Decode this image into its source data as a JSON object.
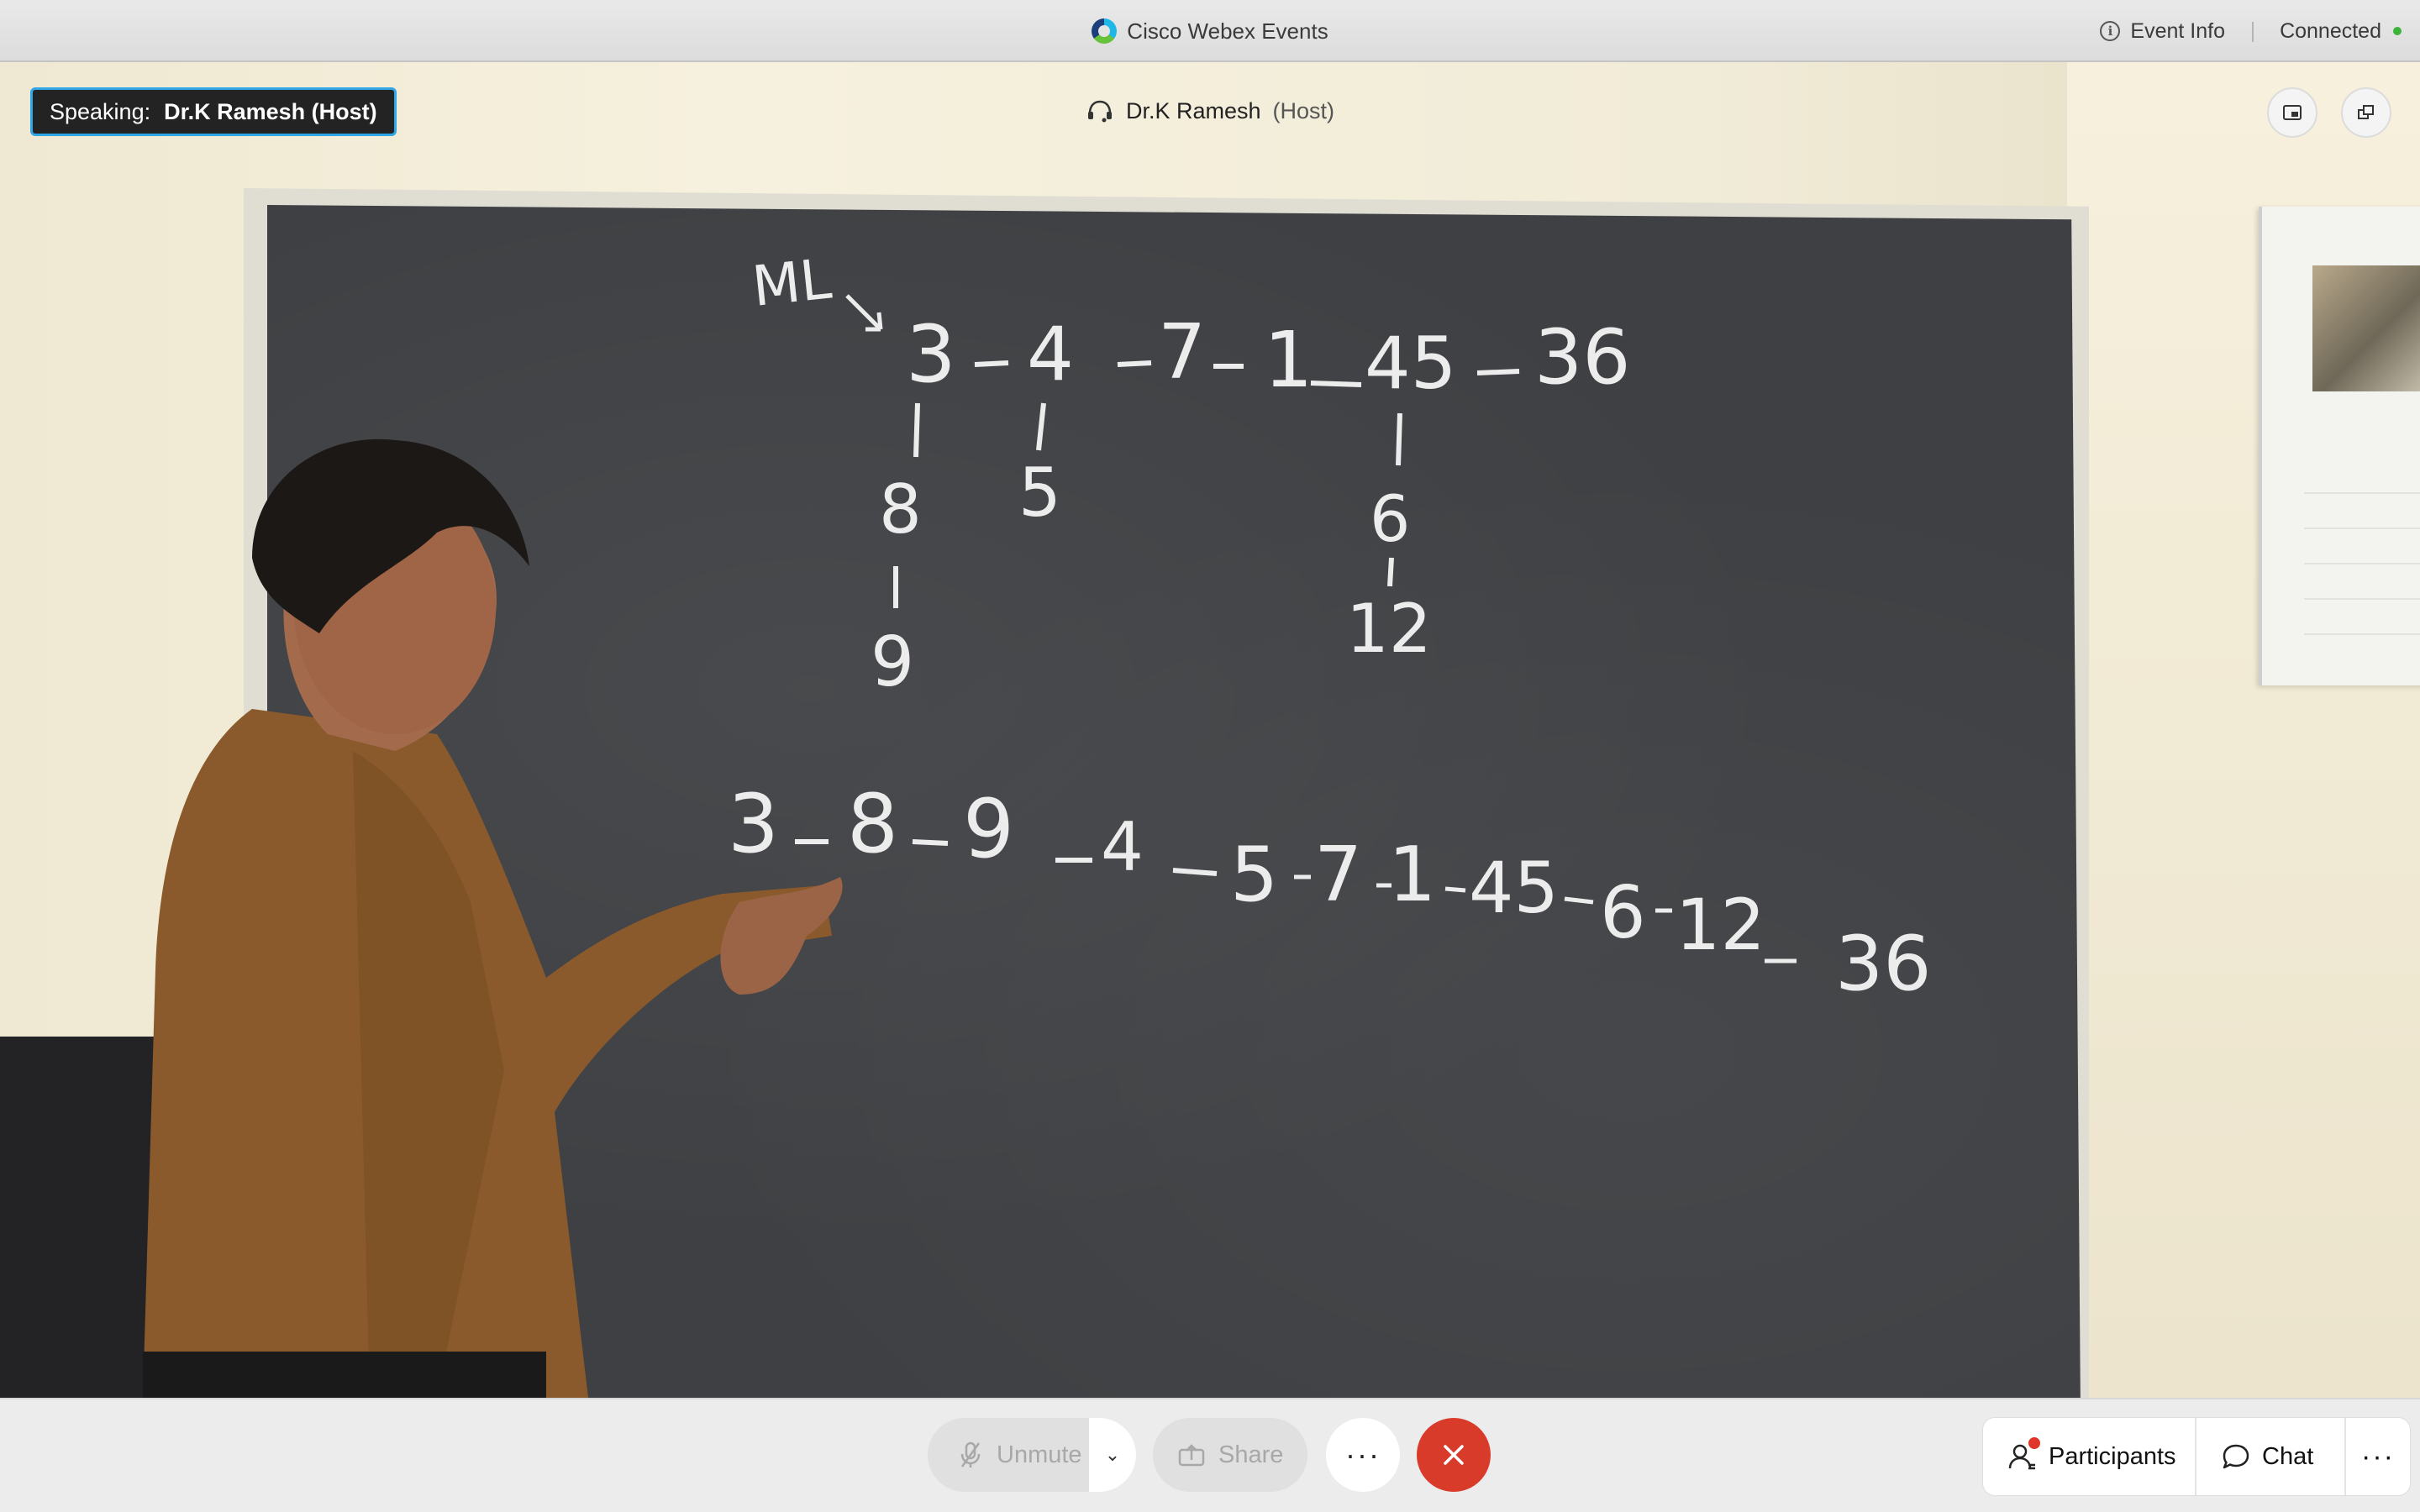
{
  "titlebar": {
    "app_title": "Cisco Webex Events",
    "event_info_label": "Event Info",
    "connection_status": "Connected"
  },
  "video": {
    "speaking_prefix": "Speaking:",
    "speaking_name": "Dr.K Ramesh (Host)",
    "presenter_name": "Dr.K Ramesh",
    "presenter_role": "(Host)",
    "board": {
      "label": "ML",
      "top_chain": [
        "3",
        "4",
        "7",
        "1",
        "45",
        "36"
      ],
      "branch_3": [
        "8",
        "9"
      ],
      "branch_4": [
        "5"
      ],
      "branch_45": [
        "6",
        "12"
      ],
      "result_chain": [
        "3",
        "8",
        "9",
        "4",
        "5",
        "7",
        "1",
        "45",
        "6",
        "12",
        "36"
      ]
    }
  },
  "controls": {
    "unmute_label": "Unmute",
    "share_label": "Share",
    "more_label": "···",
    "participants_label": "Participants",
    "chat_label": "Chat",
    "overflow_label": "···"
  },
  "colors": {
    "accent_blue": "#2fa6e6",
    "leave_red": "#d93b2b",
    "status_green": "#3cb43c",
    "blackboard": "#3e4043"
  },
  "icons": {
    "app_logo": "webex-logo-icon",
    "info": "info-icon",
    "headset": "headset-icon",
    "pip": "picture-in-picture-icon",
    "popout": "popout-window-icon",
    "mic": "microphone-muted-icon",
    "share": "share-icon",
    "leave": "close-icon",
    "participants": "participants-icon",
    "chat": "chat-icon"
  }
}
